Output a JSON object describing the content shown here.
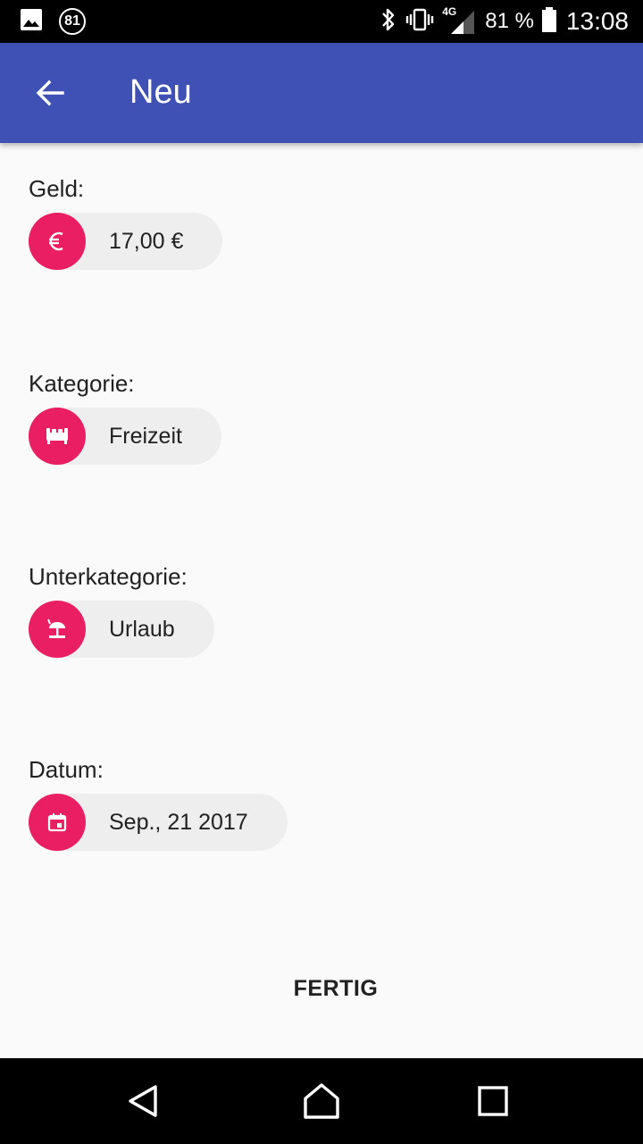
{
  "status_bar": {
    "notification_count": "81",
    "network": "4G",
    "battery_percent": "81 %",
    "time": "13:08",
    "icons": [
      "image-icon",
      "notification-badge-icon",
      "bluetooth-icon",
      "vibrate-icon",
      "signal-icon",
      "battery-icon"
    ]
  },
  "app_bar": {
    "title": "Neu",
    "back_icon": "arrow-back-icon"
  },
  "form": {
    "money": {
      "label": "Geld:",
      "value": "17,00 €",
      "icon": "euro-icon"
    },
    "category": {
      "label": "Kategorie:",
      "value": "Freizeit",
      "icon": "sofa-icon"
    },
    "subcategory": {
      "label": "Unterkategorie:",
      "value": "Urlaub",
      "icon": "beach-umbrella-icon"
    },
    "date": {
      "label": "Datum:",
      "value": "Sep., 21 2017",
      "icon": "calendar-icon"
    }
  },
  "actions": {
    "done_label": "FERTIG"
  },
  "colors": {
    "app_bar": "#3f51b5",
    "accent": "#e91e63",
    "chip_background": "#eeeeee",
    "background": "#fafafa"
  },
  "nav_bar": {
    "icons": [
      "back-triangle-icon",
      "home-icon",
      "recents-icon"
    ]
  }
}
